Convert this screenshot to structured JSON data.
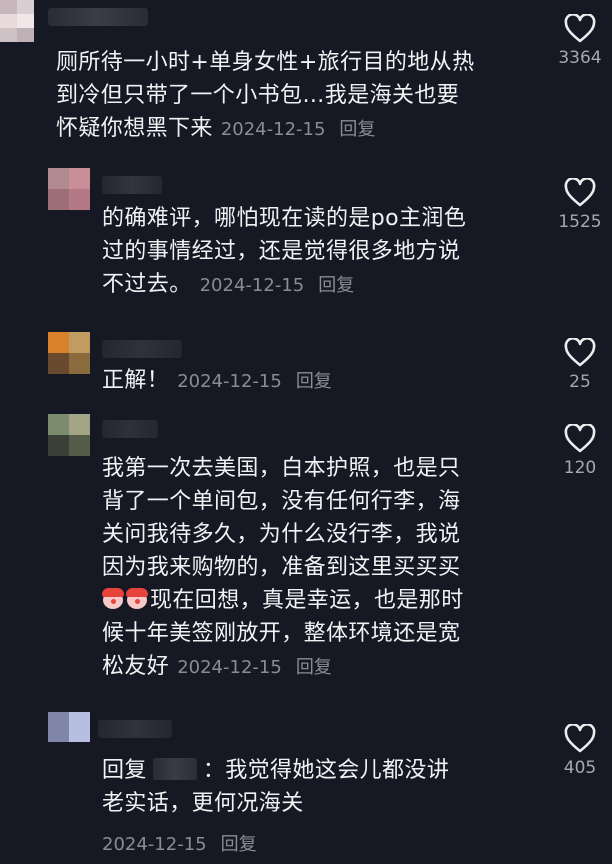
{
  "comments": [
    {
      "text_lines": [
        "厕所待一小时+单身女性+旅行目的地从热",
        "到冷但只带了一个小书包…我是海关也要",
        "怀疑你想黑下来"
      ],
      "date": "2024-12-15",
      "reply_label": "回复",
      "like_count": "3364"
    },
    {
      "text_lines": [
        "的确难评，哪怕现在读的是po主润色",
        "过的事情经过，还是觉得很多地方说",
        "不过去。"
      ],
      "date": "2024-12-15",
      "reply_label": "回复",
      "like_count": "1525"
    },
    {
      "text_lines": [
        "正解！"
      ],
      "date": "2024-12-15",
      "reply_label": "回复",
      "like_count": "25"
    },
    {
      "text_lines": [
        "我第一次去美国，白本护照，也是只",
        "背了一个单间包，没有任何行李，海",
        "关问我待多久，为什么没行李，我说",
        "因为我来购物的，准备到这里买买买",
        "现在回想，真是幸运，也是那时",
        "候十年美签刚放开，整体环境还是宽",
        "松友好"
      ],
      "emoji": "clown-face-emoji",
      "date": "2024-12-15",
      "reply_label": "回复",
      "like_count": "120"
    },
    {
      "reply_prefix": "回复",
      "text_after_name": "：我觉得她这会儿都没讲",
      "text_line2": "老实话，更何况海关",
      "date": "2024-12-15",
      "reply_label": "回复",
      "like_count": "405"
    }
  ],
  "colors": {
    "background": "#161823",
    "text": "#f2f2f4",
    "meta": "#8b8c93",
    "heart_outline": "#ececef"
  },
  "icons": {
    "like": "heart-outline-icon"
  }
}
